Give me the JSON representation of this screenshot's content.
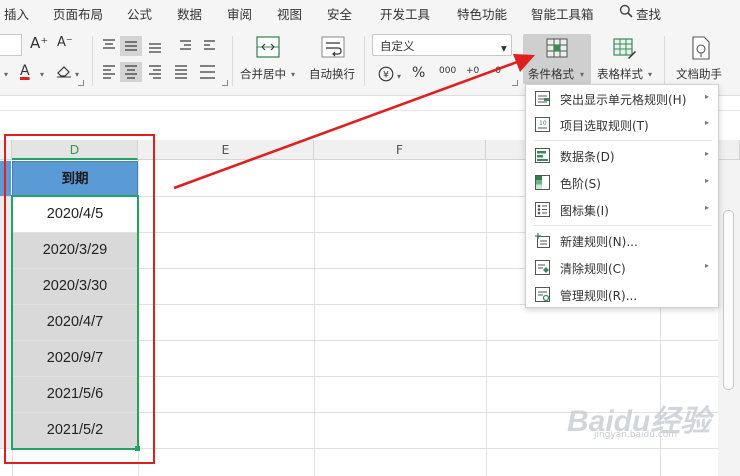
{
  "menu": {
    "items": [
      "插入",
      "页面布局",
      "公式",
      "数据",
      "审阅",
      "视图",
      "安全",
      "开发工具",
      "特色功能",
      "智能工具箱"
    ],
    "search": "查找"
  },
  "toolbar": {
    "font_grow": "A⁺",
    "font_shrink": "A⁻",
    "font_color": "A",
    "number_format": "自定义",
    "percent": "%",
    "thousands": "000",
    "dec_add": "+0",
    "dec_sub": "-0",
    "merge_center": "合并居中",
    "wrap_text": "自动换行",
    "conditional_format": "条件格式",
    "table_style": "表格样式",
    "doc_assistant": "文档助手"
  },
  "sheet": {
    "columns": [
      "D",
      "E",
      "F"
    ],
    "header_cell": "到期",
    "dates": [
      "2020/4/5",
      "2020/3/29",
      "2020/3/30",
      "2020/4/7",
      "2020/9/7",
      "2021/5/6",
      "2021/5/2"
    ]
  },
  "dropdown": {
    "items": [
      {
        "label": "突出显示单元格规则(H)",
        "icon": "highlight-rules-icon",
        "submenu": true
      },
      {
        "label": "项目选取规则(T)",
        "icon": "top-bottom-rules-icon",
        "submenu": true
      },
      {
        "label": "数据条(D)",
        "icon": "data-bars-icon",
        "submenu": true
      },
      {
        "label": "色阶(S)",
        "icon": "color-scales-icon",
        "submenu": true
      },
      {
        "label": "图标集(I)",
        "icon": "icon-sets-icon",
        "submenu": true
      },
      {
        "label": "新建规则(N)...",
        "icon": "new-rule-icon",
        "submenu": false
      },
      {
        "label": "清除规则(C)",
        "icon": "clear-rules-icon",
        "submenu": true
      },
      {
        "label": "管理规则(R)...",
        "icon": "manage-rules-icon",
        "submenu": false
      }
    ]
  },
  "watermark": {
    "text": "Baidu经验",
    "sub": "jingyan.baidu.com"
  },
  "colors": {
    "header_fill": "#5b9bd5",
    "date_fill": "#d9d9d9",
    "annotation_red": "#e02020",
    "selection_green": "#21a366"
  }
}
